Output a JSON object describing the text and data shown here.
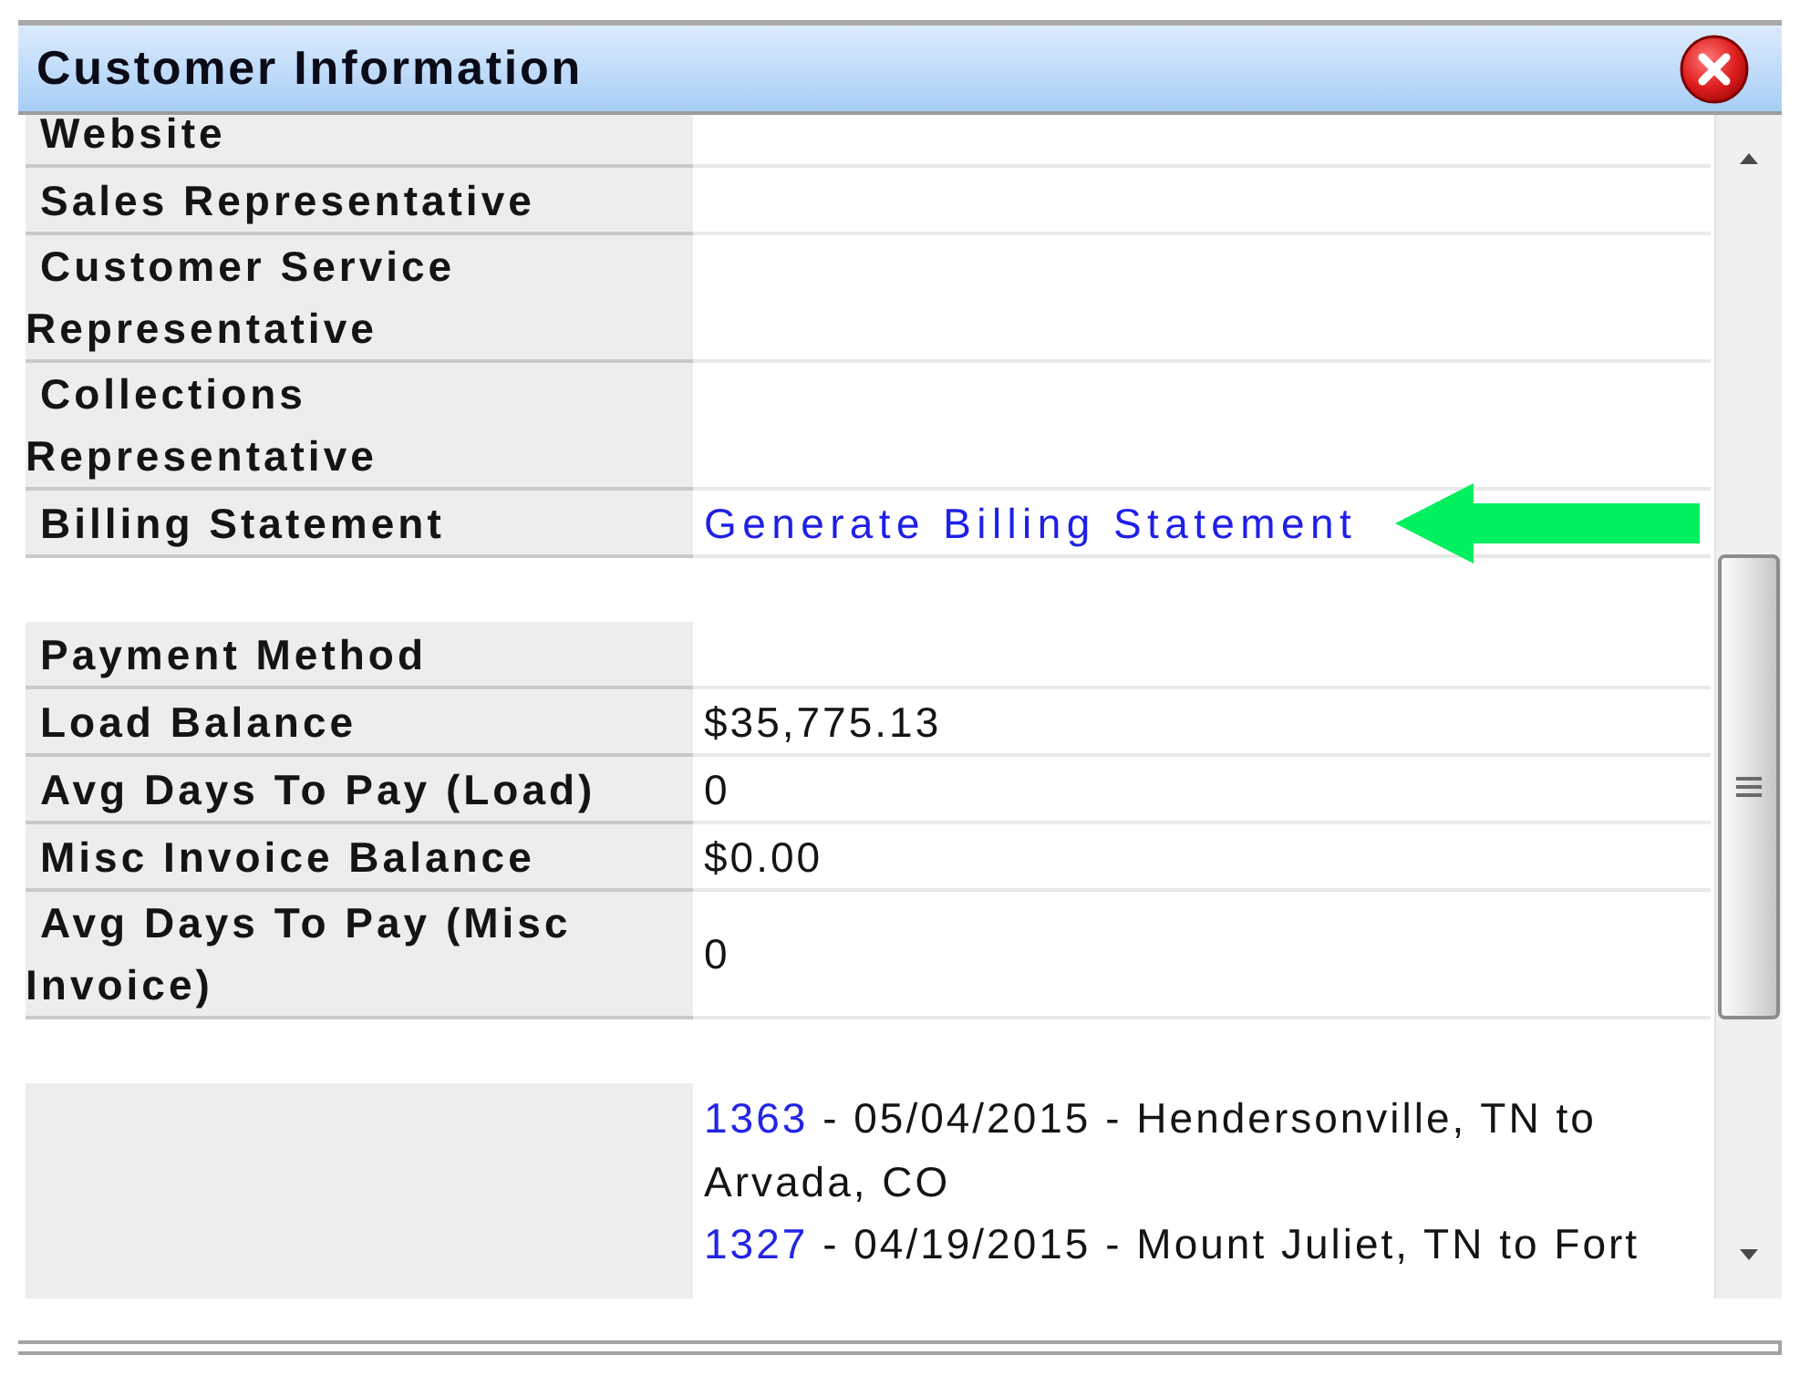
{
  "window": {
    "title": "Customer Information"
  },
  "sections": [
    {
      "rows": [
        {
          "kind": "text",
          "label": "Website"
        },
        {
          "kind": "text",
          "label": "Sales Representative"
        },
        {
          "kind": "text",
          "label": "Customer Service Representative"
        },
        {
          "kind": "text",
          "label": "Collections Representative"
        },
        {
          "kind": "link",
          "label": "Billing Statement",
          "value": "Generate Billing Statement"
        }
      ]
    },
    {
      "rows": [
        {
          "kind": "text",
          "label": "Payment Method"
        },
        {
          "kind": "text",
          "label": "Load Balance",
          "value": "$35,775.13"
        },
        {
          "kind": "text",
          "label": "Avg Days To Pay (Load)",
          "value": "0"
        },
        {
          "kind": "text",
          "label": "Misc Invoice Balance",
          "value": "$0.00"
        },
        {
          "kind": "text",
          "label": "Avg Days To Pay (Misc Invoice)",
          "value": "0"
        }
      ]
    },
    {
      "rows": [
        {
          "kind": "loads",
          "loads": [
            {
              "number": "1363",
              "description": "- 05/04/2015 - Hendersonville, TN to Arvada, CO"
            },
            {
              "number": "1327",
              "description": "- 04/19/2015 - Mount Juliet, TN to Fort"
            }
          ]
        }
      ]
    }
  ]
}
